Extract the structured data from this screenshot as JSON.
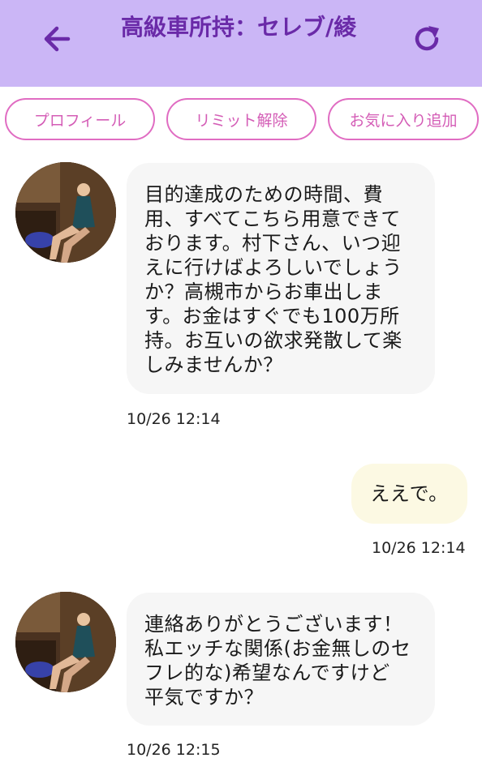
{
  "header": {
    "title": "高級車所持：セレブ/綾",
    "back_icon": "arrow-left-icon",
    "refresh_icon": "refresh-icon",
    "background_color": "#cbb6f6",
    "title_color": "#6a2aa8"
  },
  "actions": {
    "profile": "プロフィール",
    "limit_release": "リミット解除",
    "add_favorite": "お気に入り追加",
    "border_color": "#e06cc2"
  },
  "messages": [
    {
      "direction": "incoming",
      "text": "目的達成のための時間、費\n用、すべてこちら用意できて\nおります。村下さん、いつ迎\nえに行けばよろしいでしょう\nか？高槻市からお車出しま\nす。お金はすぐでも100万所\n持。お互いの欲求発散して楽\nしみませんか？",
      "timestamp": "10/26 12:14"
    },
    {
      "direction": "outgoing",
      "text": "ええで。",
      "timestamp": "10/26 12:14"
    },
    {
      "direction": "incoming",
      "text": "連絡ありがとうございます！\n私エッチな関係(お金無しのセ\nフレ的な)希望なんですけど\n平気ですか？",
      "timestamp": "10/26 12:15"
    }
  ]
}
